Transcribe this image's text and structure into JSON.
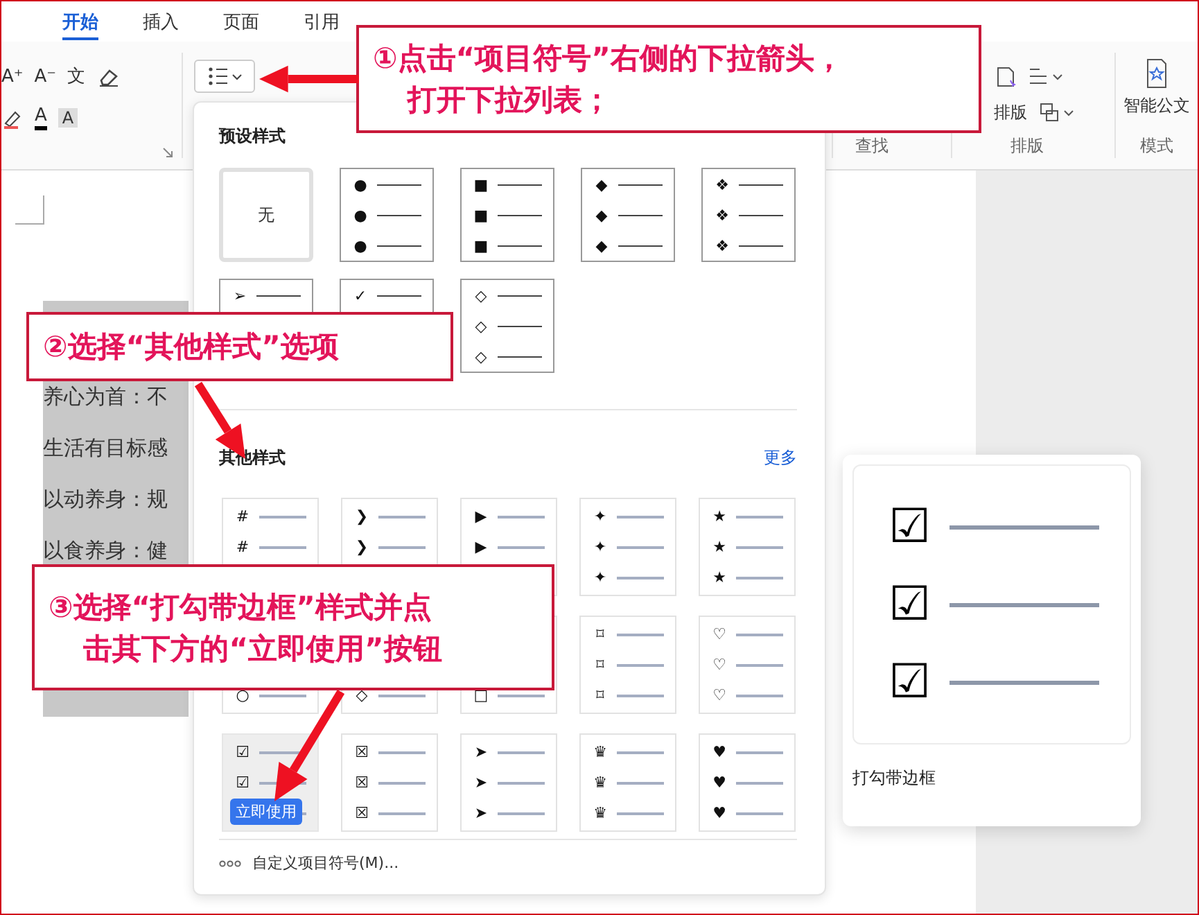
{
  "tabs": [
    {
      "label": "开始",
      "selected": true
    },
    {
      "label": "插入",
      "selected": false
    },
    {
      "label": "页面",
      "selected": false
    },
    {
      "label": "引用",
      "selected": false
    }
  ],
  "ribbon": {
    "font_tools": [
      "A⁺",
      "A⁻",
      "文"
    ],
    "font_color": "A",
    "shading": "A",
    "find_group": {
      "label": "查找"
    },
    "layout_group": {
      "label": "排版",
      "button": "排版"
    },
    "mode_group": {
      "label": "模式",
      "button": "智能公文"
    }
  },
  "document": {
    "lines": [
      "养心为首：不",
      "生活有目标感",
      "以动养身：规",
      "以食养身：健"
    ]
  },
  "bullet_menu": {
    "preset": {
      "title": "预设样式",
      "items": [
        {
          "kind": "none",
          "label": "无",
          "selected": true
        },
        {
          "kind": "bullet",
          "symbol": "●",
          "selected": false
        },
        {
          "kind": "bullet",
          "symbol": "■",
          "selected": false
        },
        {
          "kind": "bullet",
          "symbol": "◆",
          "selected": false
        },
        {
          "kind": "bullet",
          "symbol": "❖",
          "selected": false
        },
        {
          "kind": "bullet",
          "symbol": "➢",
          "selected": false
        },
        {
          "kind": "bullet",
          "symbol": "✓",
          "selected": false
        },
        {
          "kind": "bullet",
          "symbol": "◇",
          "selected": false
        }
      ]
    },
    "other": {
      "title": "其他样式",
      "more": "更多",
      "items": [
        {
          "symbol": "#",
          "hovered": false
        },
        {
          "symbol": "❯",
          "hovered": false
        },
        {
          "symbol": "▶",
          "hovered": false
        },
        {
          "symbol": "✦",
          "hovered": false
        },
        {
          "symbol": "★",
          "hovered": false
        },
        {
          "symbol": "○",
          "hovered": false
        },
        {
          "symbol": "◇",
          "hovered": false
        },
        {
          "symbol": "□",
          "hovered": false
        },
        {
          "symbol": "⌑",
          "hovered": false
        },
        {
          "symbol": "♡",
          "hovered": false
        },
        {
          "symbol": "☑",
          "hovered": true,
          "button": "立即使用"
        },
        {
          "symbol": "☒",
          "hovered": false
        },
        {
          "symbol": "➤",
          "hovered": false
        },
        {
          "symbol": "♛",
          "hovered": false
        },
        {
          "symbol": "♥",
          "hovered": false
        }
      ]
    },
    "custom": "自定义项目符号(M)..."
  },
  "preview": {
    "symbol": "☑",
    "caption": "打勾带边框"
  },
  "callouts": [
    {
      "lines": [
        "①点击“项目符号”右侧的下拉箭头，",
        "打开下拉列表；"
      ]
    },
    {
      "lines": [
        "②选择“其他样式”选项"
      ]
    },
    {
      "lines": [
        "③选择“打勾带边框”样式并点",
        "击其下方的“立即使用”按钮"
      ]
    }
  ]
}
